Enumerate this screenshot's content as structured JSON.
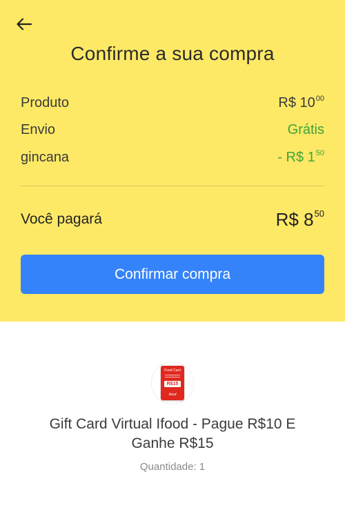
{
  "header": {
    "back_icon": "arrow-left-icon",
    "title": "Confirme a sua compra"
  },
  "summary": {
    "rows": [
      {
        "label": "Produto",
        "value_main": "R$ 10",
        "value_cents": "00"
      },
      {
        "label": "Envio",
        "value_main": "Grátis",
        "value_cents": ""
      },
      {
        "label": "gincana",
        "value_main": "- R$ 1",
        "value_cents": "50"
      }
    ],
    "total_label": "Você pagará",
    "total_main": "R$ 8",
    "total_cents": "50"
  },
  "confirm_button": {
    "label": "Confirmar compra"
  },
  "product": {
    "image": {
      "card_brand": "Food Card",
      "card_value": "R$15",
      "card_logo": "ifood"
    },
    "name": "Gift Card Virtual Ifood - Pague R$10 E Ganhe R$15",
    "quantity": "Quantidade: 1"
  },
  "colors": {
    "header_bg": "#fde966",
    "accent": "#3483fa",
    "green": "#3fa33a"
  }
}
